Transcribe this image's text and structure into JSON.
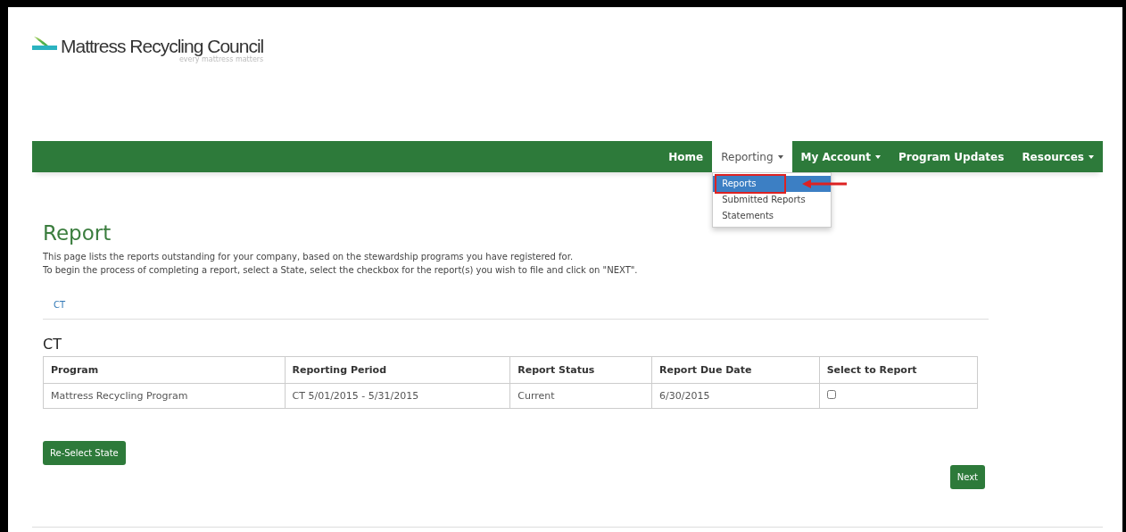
{
  "logo": {
    "name": "Mattress Recycling Council",
    "tagline": "every mattress matters"
  },
  "nav": [
    {
      "label": "Home",
      "selected": false,
      "dropdown": false
    },
    {
      "label": "Reporting",
      "selected": true,
      "dropdown": true
    },
    {
      "label": "My Account",
      "selected": false,
      "dropdown": true
    },
    {
      "label": "Program Updates",
      "selected": false,
      "dropdown": false
    },
    {
      "label": "Resources",
      "selected": false,
      "dropdown": true
    }
  ],
  "menu": [
    {
      "label": "Reports",
      "selected": true
    },
    {
      "label": "Submitted Reports",
      "selected": false
    },
    {
      "label": "Statements",
      "selected": false
    }
  ],
  "title": "Report",
  "intro": [
    "This page lists the reports outstanding for your company, based on the stewardship programs you have registered for.",
    "To begin the process of completing a report, select a State, select the checkbox for the report(s) you wish to file and click on \"NEXT\"."
  ],
  "state_links": [
    "CT"
  ],
  "section": "CT",
  "table": {
    "columns": [
      "Program",
      "Reporting Period",
      "Report Status",
      "Report Due Date",
      "Select to Report"
    ],
    "rows": [
      {
        "program": "Mattress Recycling Program",
        "period": "CT 5/01/2015 - 5/31/2015",
        "status": "Current",
        "due": "6/30/2015",
        "checked": false
      }
    ]
  },
  "buttons": {
    "reselect": "Re-Select State",
    "next": "Next"
  }
}
